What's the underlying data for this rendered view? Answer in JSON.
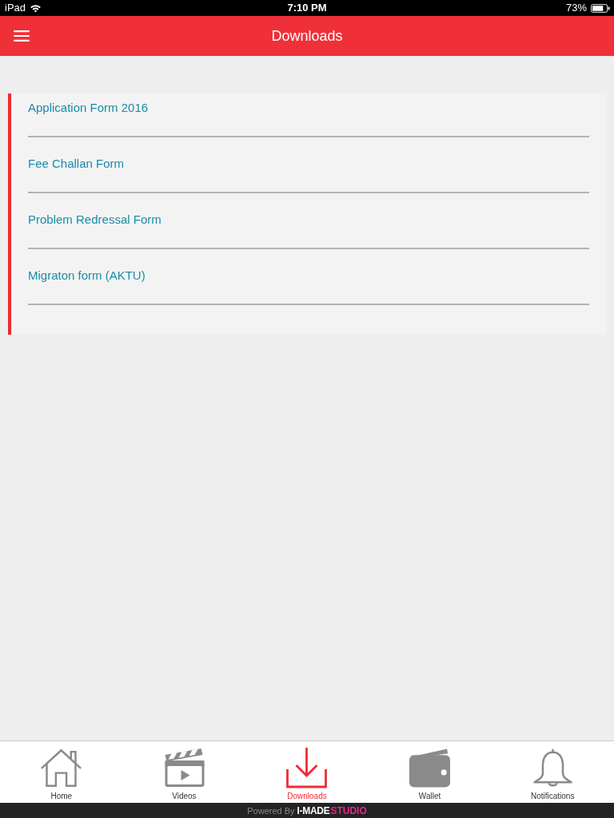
{
  "status_bar": {
    "carrier": "iPad",
    "time": "7:10 PM",
    "battery": "73%"
  },
  "header": {
    "title": "Downloads"
  },
  "downloads": [
    {
      "label": "Application Form 2016"
    },
    {
      "label": "Fee Challan Form"
    },
    {
      "label": "Problem Redressal Form"
    },
    {
      "label": "Migraton form (AKTU)"
    }
  ],
  "tab_bar": [
    {
      "kind": "home",
      "label": "Home",
      "selected": false
    },
    {
      "kind": "videos",
      "label": "Videos",
      "selected": false
    },
    {
      "kind": "downloads",
      "label": "Downloads",
      "selected": true
    },
    {
      "kind": "wallet",
      "label": "Wallet",
      "selected": false
    },
    {
      "kind": "notifications",
      "label": "Notifications",
      "selected": false
    }
  ],
  "footer": {
    "prefix": "Powered By",
    "brand": "I-MADE",
    "brand_suffix": "STUDIO"
  }
}
